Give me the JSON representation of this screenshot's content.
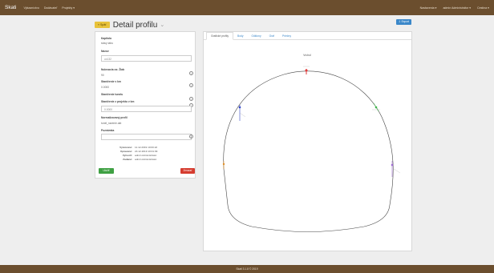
{
  "navbar": {
    "brand": "Skati",
    "links": [
      "Výkazníctvo",
      "Dodávateľ",
      "Projekty ▾"
    ],
    "right_links": [
      "Nastavenia ▾",
      "admin Administrátor ▾",
      "Cestina ▾"
    ]
  },
  "header": {
    "back_label": "« Späť",
    "title": "Detail profilu",
    "export_label": "⇩ Export"
  },
  "form": {
    "fields": [
      {
        "label": "Kapitola",
        "value": "stavy tabu"
      },
      {
        "label": "Názov",
        "value": "ux132"
      },
      {
        "label": "Nulovacia os: Žiab",
        "value": "90"
      },
      {
        "label": "Staničenie v km",
        "value": "0.0000"
      },
      {
        "label": "Staničenie tunelu",
        "value": ""
      },
      {
        "label": "Staničenie z projektu v km",
        "value": "0.0000"
      },
      {
        "label": "Normalizovaný profil",
        "value": "tunel_razenie.dat"
      },
      {
        "label": "Poznámka",
        "value": ""
      }
    ],
    "meta": [
      {
        "key": "Vytvorené:",
        "value": "11.12.2019 10:00:22"
      },
      {
        "key": "Upravené:",
        "value": "24.12.2019 10:01:09"
      },
      {
        "key": "Vytvoril:",
        "value": "admin Administrátor"
      },
      {
        "key": "Zadané:",
        "value": "admin Administrátor"
      }
    ],
    "save_label": "Uložiť",
    "delete_label": "Zmazať"
  },
  "tabs": [
    "Grafické profily",
    "Body",
    "Odklony",
    "Graf",
    "Priečny"
  ],
  "drawing": {
    "top_label": "Vrchol",
    "markers": [
      {
        "name": "top",
        "color": "#e23b3b"
      },
      {
        "name": "right-upper",
        "color": "#3fb54b"
      },
      {
        "name": "left-upper",
        "color": "#3246c8"
      },
      {
        "name": "left-lower",
        "color": "#e0902a"
      },
      {
        "name": "right-lower",
        "color": "#9d6bd1"
      }
    ]
  },
  "footer": {
    "text": "Skati 3.1.8 © 2019"
  }
}
